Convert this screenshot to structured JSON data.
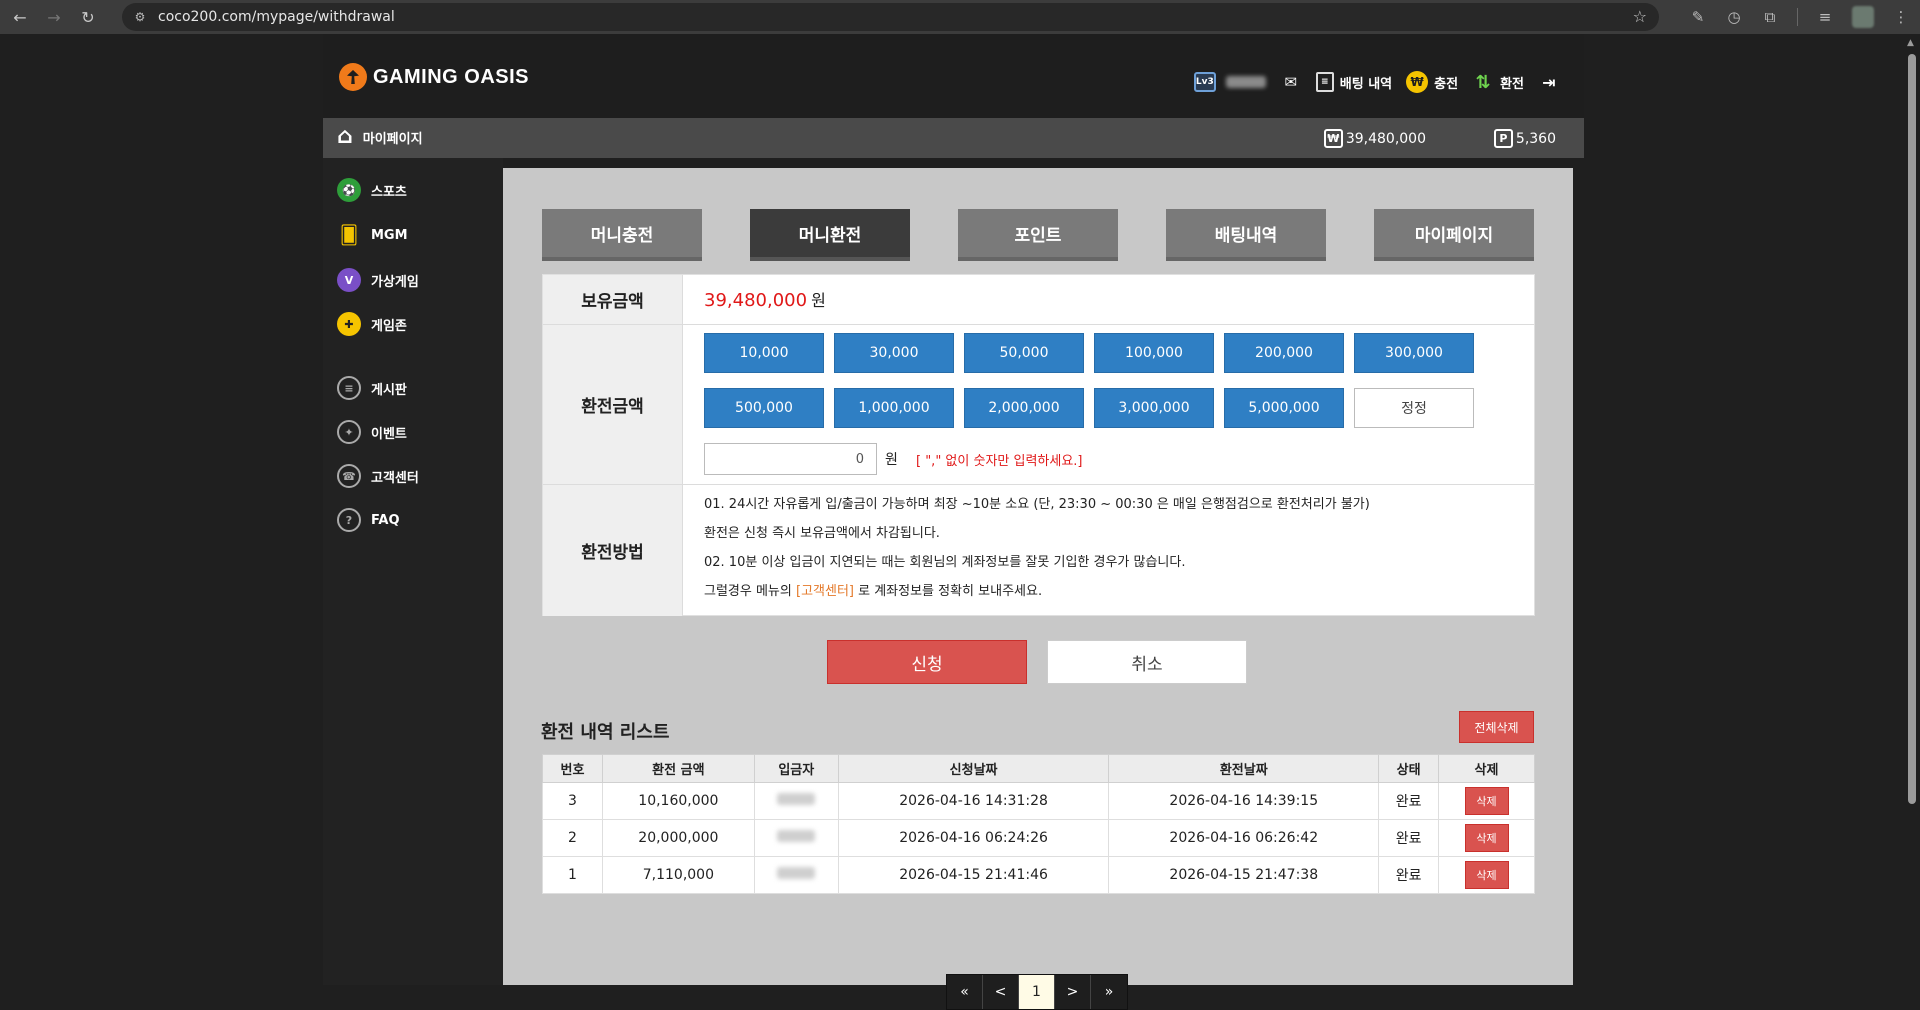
{
  "browser": {
    "url": "coco200.com/mypage/withdrawal"
  },
  "header": {
    "logo_text": "GAMING OASIS",
    "level_badge": "Lv3",
    "nav": {
      "bet_history": "배팅 내역",
      "charge": "충전",
      "exchange": "환전"
    }
  },
  "subbar": {
    "mypage_label": "마이페이지",
    "money_icon": "₩",
    "money": "39,480,000",
    "points_icon": "P",
    "points": "5,360"
  },
  "sidebar": {
    "items": [
      {
        "label": "스포츠",
        "icon": "sports-icon"
      },
      {
        "label": "MGM",
        "icon": "cards-icon"
      },
      {
        "label": "가상게임",
        "icon": "virtual-game-icon"
      },
      {
        "label": "게임존",
        "icon": "gamepad-icon"
      },
      {
        "label": "게시판",
        "icon": "board-icon"
      },
      {
        "label": "이벤트",
        "icon": "event-icon"
      },
      {
        "label": "고객센터",
        "icon": "support-icon"
      },
      {
        "label": "FAQ",
        "icon": "faq-icon"
      }
    ]
  },
  "tabs": [
    "머니충전",
    "머니환전",
    "포인트",
    "배팅내역",
    "마이페이지"
  ],
  "form": {
    "balance_label": "보유금액",
    "balance_value": "39,480,000",
    "balance_unit": "원",
    "amount_label": "환전금액",
    "amount_buttons": [
      "10,000",
      "30,000",
      "50,000",
      "100,000",
      "200,000",
      "300,000",
      "500,000",
      "1,000,000",
      "2,000,000",
      "3,000,000",
      "5,000,000",
      "정정"
    ],
    "amount_value": "0",
    "amount_unit": "원",
    "amount_hint": "[ \",\" 없이 숫자만 입력하세요.]",
    "method_label": "환전방법",
    "method_line1": "01. 24시간 자유롭게 입/출금이 가능하며 최장 ~10분 소요 (단, 23:30 ~ 00:30 은 매일 은행점검으로 환전처리가 불가)",
    "method_line2": "환전은 신청 즉시 보유금액에서 차감됩니다.",
    "method_line3": "02. 10분 이상 입금이 지연되는 때는 회원님의 계좌정보를 잘못 기입한 경우가 많습니다.",
    "method_line4_pre": "그럴경우 메뉴의 ",
    "method_line4_link": "[고객센터]",
    "method_line4_post": " 로 계좌정보를 정확히 보내주세요.",
    "submit": "신청",
    "cancel": "취소"
  },
  "history": {
    "title": "환전 내역 리스트",
    "delete_all": "전체삭제",
    "columns": [
      "번호",
      "환전 금액",
      "입금자",
      "신청날짜",
      "환전날짜",
      "상태",
      "삭제"
    ],
    "rows": [
      {
        "no": "3",
        "amount": "10,160,000",
        "requested": "2026-04-16 14:31:28",
        "exchanged": "2026-04-16 14:39:15",
        "status": "완료",
        "delete": "삭제"
      },
      {
        "no": "2",
        "amount": "20,000,000",
        "requested": "2026-04-16 06:24:26",
        "exchanged": "2026-04-16 06:26:42",
        "status": "완료",
        "delete": "삭제"
      },
      {
        "no": "1",
        "amount": "7,110,000",
        "requested": "2026-04-15 21:41:46",
        "exchanged": "2026-04-15 21:47:38",
        "status": "완료",
        "delete": "삭제"
      }
    ]
  },
  "pagination": {
    "first": "«",
    "prev": "<",
    "current": "1",
    "next": ">",
    "last": "»"
  }
}
